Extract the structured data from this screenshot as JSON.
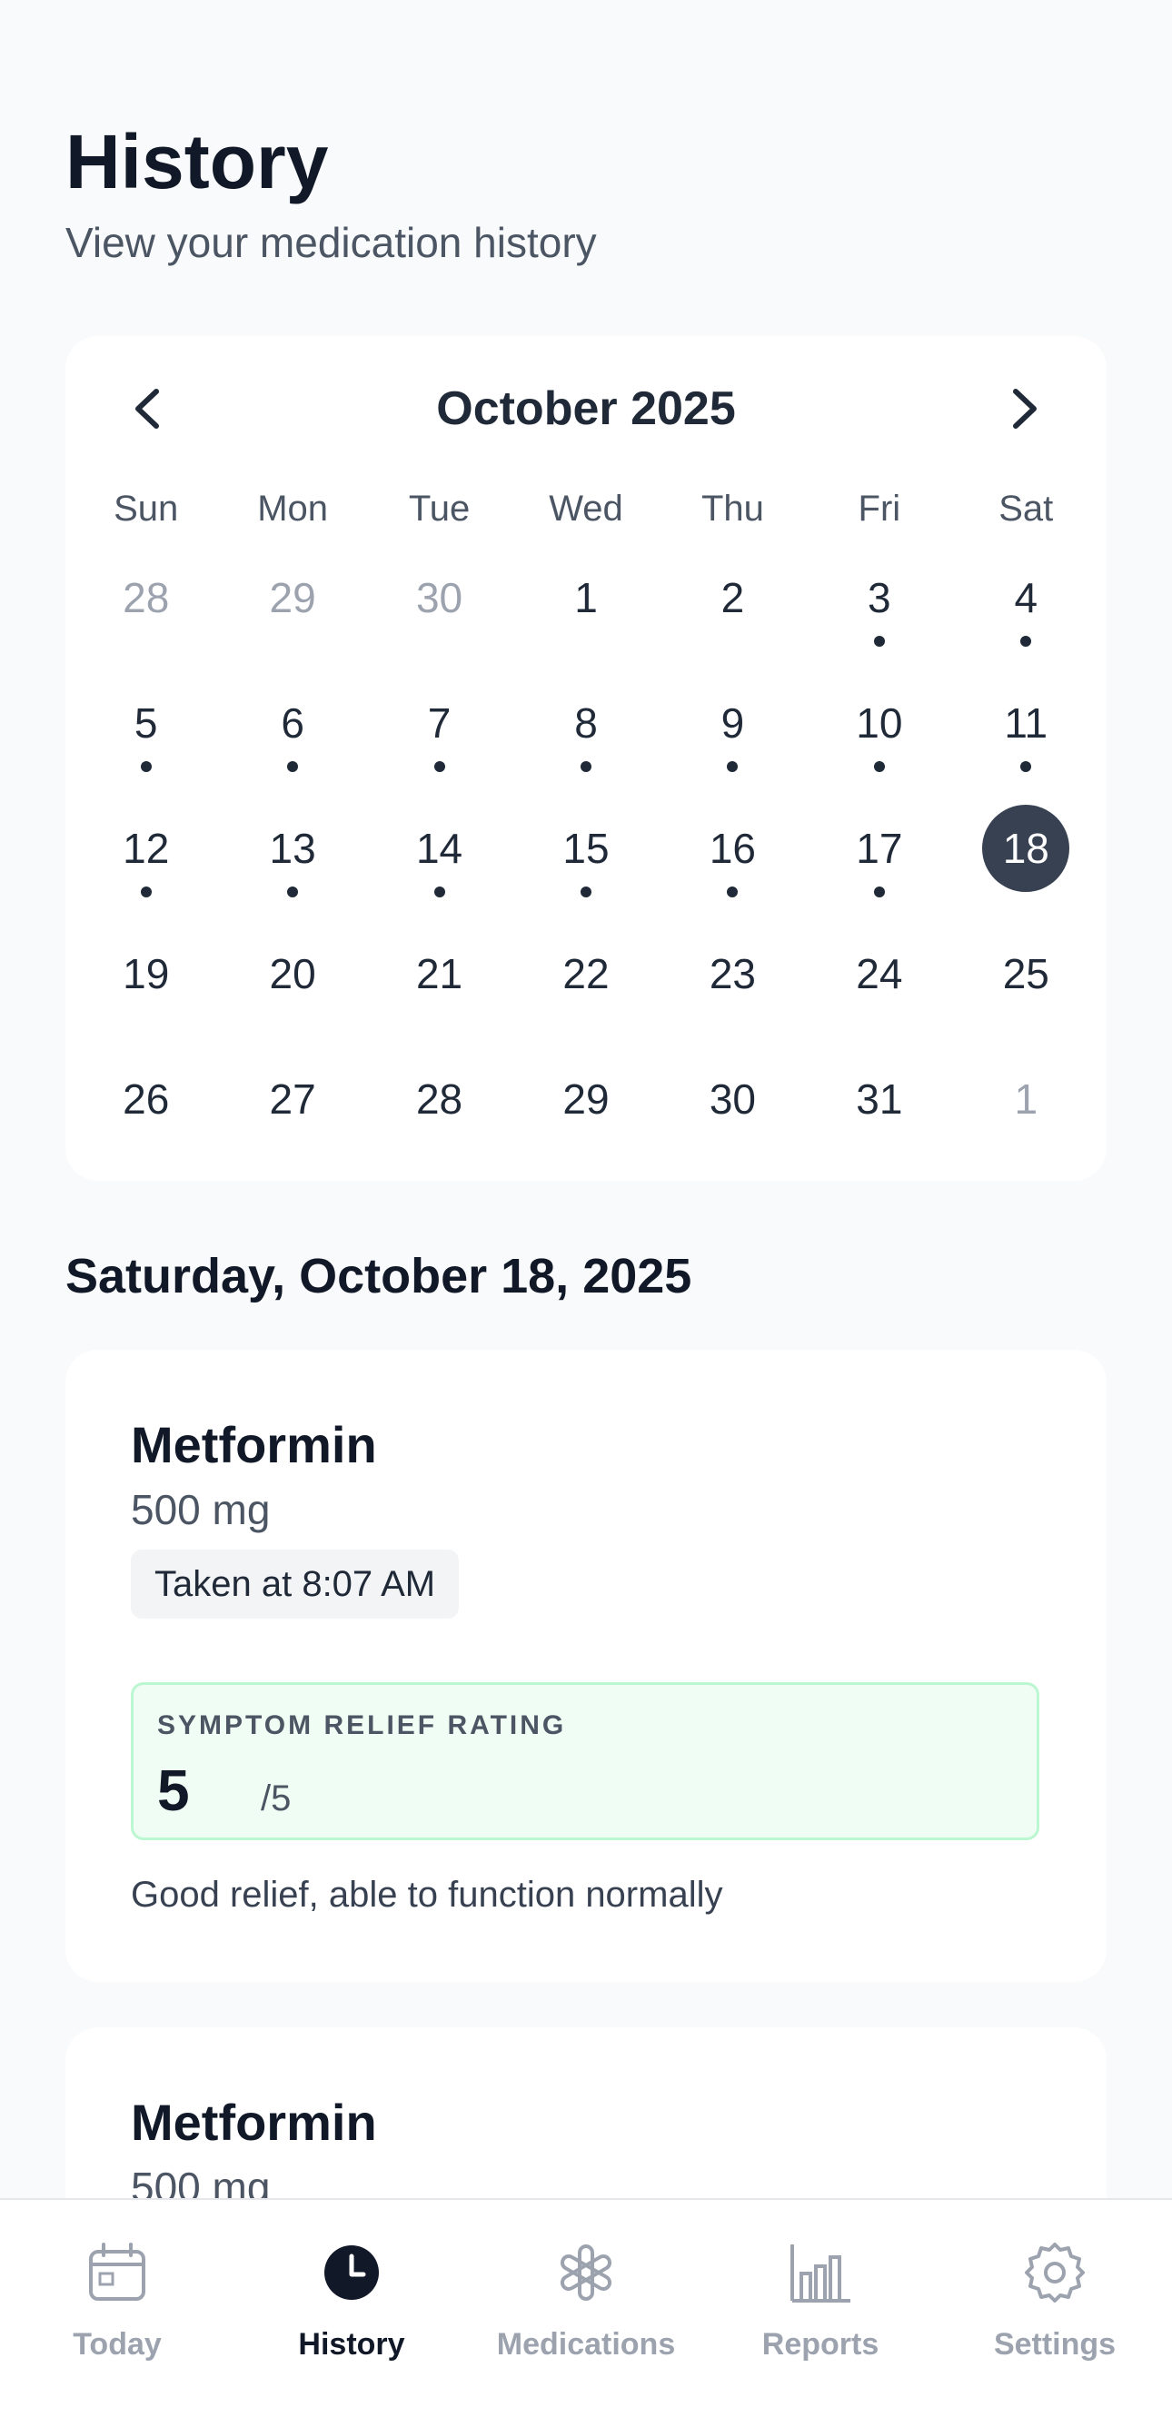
{
  "header": {
    "title": "History",
    "subtitle": "View your medication history"
  },
  "calendar": {
    "month_label": "October 2025",
    "weekdays": [
      "Sun",
      "Mon",
      "Tue",
      "Wed",
      "Thu",
      "Fri",
      "Sat"
    ],
    "selected_day": "18",
    "days": [
      {
        "n": "28",
        "muted": true,
        "dot": false
      },
      {
        "n": "29",
        "muted": true,
        "dot": false
      },
      {
        "n": "30",
        "muted": true,
        "dot": false
      },
      {
        "n": "1",
        "muted": false,
        "dot": false
      },
      {
        "n": "2",
        "muted": false,
        "dot": false
      },
      {
        "n": "3",
        "muted": false,
        "dot": true
      },
      {
        "n": "4",
        "muted": false,
        "dot": true
      },
      {
        "n": "5",
        "muted": false,
        "dot": true
      },
      {
        "n": "6",
        "muted": false,
        "dot": true
      },
      {
        "n": "7",
        "muted": false,
        "dot": true
      },
      {
        "n": "8",
        "muted": false,
        "dot": true
      },
      {
        "n": "9",
        "muted": false,
        "dot": true
      },
      {
        "n": "10",
        "muted": false,
        "dot": true
      },
      {
        "n": "11",
        "muted": false,
        "dot": true
      },
      {
        "n": "12",
        "muted": false,
        "dot": true
      },
      {
        "n": "13",
        "muted": false,
        "dot": true
      },
      {
        "n": "14",
        "muted": false,
        "dot": true
      },
      {
        "n": "15",
        "muted": false,
        "dot": true
      },
      {
        "n": "16",
        "muted": false,
        "dot": true
      },
      {
        "n": "17",
        "muted": false,
        "dot": true
      },
      {
        "n": "18",
        "muted": false,
        "dot": false,
        "selected": true
      },
      {
        "n": "19",
        "muted": false,
        "dot": false
      },
      {
        "n": "20",
        "muted": false,
        "dot": false
      },
      {
        "n": "21",
        "muted": false,
        "dot": false
      },
      {
        "n": "22",
        "muted": false,
        "dot": false
      },
      {
        "n": "23",
        "muted": false,
        "dot": false
      },
      {
        "n": "24",
        "muted": false,
        "dot": false
      },
      {
        "n": "25",
        "muted": false,
        "dot": false
      },
      {
        "n": "26",
        "muted": false,
        "dot": false
      },
      {
        "n": "27",
        "muted": false,
        "dot": false
      },
      {
        "n": "28",
        "muted": false,
        "dot": false
      },
      {
        "n": "29",
        "muted": false,
        "dot": false
      },
      {
        "n": "30",
        "muted": false,
        "dot": false
      },
      {
        "n": "31",
        "muted": false,
        "dot": false
      },
      {
        "n": "1",
        "muted": true,
        "dot": false
      }
    ]
  },
  "selected_date_label": "Saturday, October 18, 2025",
  "entries": [
    {
      "name": "Metformin",
      "dose": "500 mg",
      "taken_label": "Taken at 8:07 AM",
      "rating_label": "SYMPTOM RELIEF RATING",
      "rating_value": "5",
      "rating_max": "/5",
      "note": "Good relief, able to function normally"
    },
    {
      "name": "Metformin",
      "dose": "500 mg"
    }
  ],
  "tabbar": {
    "tabs": [
      {
        "label": "Today",
        "icon": "calendar-icon",
        "active": false
      },
      {
        "label": "History",
        "icon": "clock-icon",
        "active": true
      },
      {
        "label": "Medications",
        "icon": "asterisk-icon",
        "active": false
      },
      {
        "label": "Reports",
        "icon": "bar-chart-icon",
        "active": false
      },
      {
        "label": "Settings",
        "icon": "gear-icon",
        "active": false
      }
    ]
  },
  "colors": {
    "selected_day_bg": "#374151",
    "rating_bg": "#f0fdf4",
    "rating_border": "#bbf7d0",
    "active_tab": "#111827",
    "inactive_tab": "#9ca3af"
  }
}
